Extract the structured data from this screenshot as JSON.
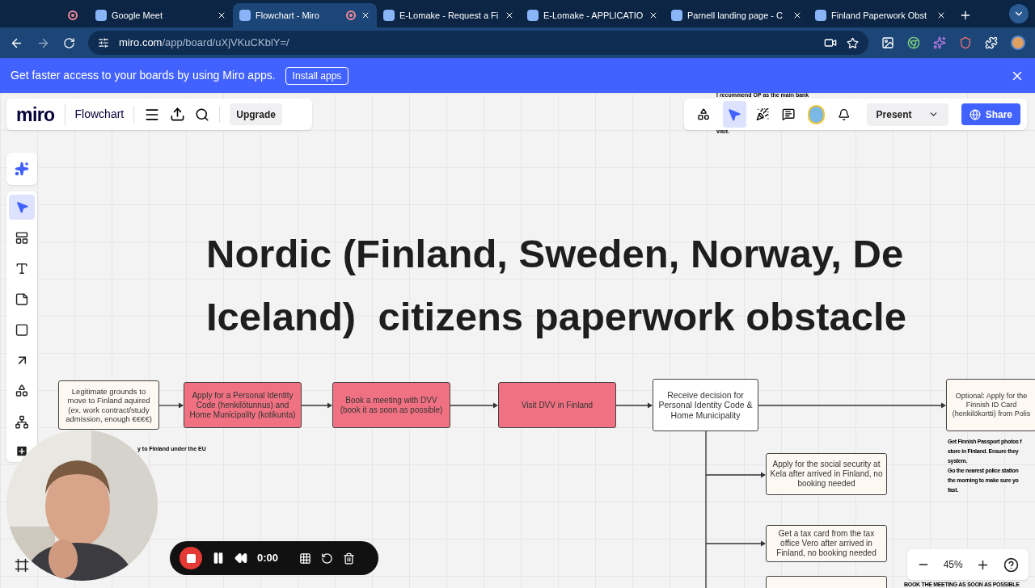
{
  "browser": {
    "tabs": [
      {
        "recording": true,
        "selected": false
      },
      {
        "title": "Google Meet",
        "recording": false,
        "selected": false
      },
      {
        "title": "Flowchart - Miro",
        "recording": true,
        "selected": true
      },
      {
        "title": "E-Lomake - Request a Fi",
        "recording": false,
        "selected": false
      },
      {
        "title": "E-Lomake - APPLICATIO",
        "recording": false,
        "selected": false
      },
      {
        "title": "Parnell landing page - C",
        "recording": false,
        "selected": false
      },
      {
        "title": "Finland Paperwork Obst",
        "recording": false,
        "selected": false
      }
    ],
    "url_host": "miro.com",
    "url_path": "/app/board/uXjVKuCKblY=/"
  },
  "banner": {
    "text": "Get faster access to your boards by using Miro apps.",
    "button": "Install apps"
  },
  "board_bar": {
    "logo": "miro",
    "board_name": "Flowchart",
    "upgrade": "Upgrade"
  },
  "top_toolbar": {
    "present": "Present",
    "share": "Share"
  },
  "canvas": {
    "title_lines": [
      "Nordic (Finland, Sweden, Norway, De",
      "Iceland)  citizens paperwork obstacle"
    ],
    "nodes": [
      {
        "text": "Legitimate grounds to move to Finland aquired (ex. work contract/study admission, enough €€€€)",
        "color": "#fdf8f1"
      },
      {
        "text": "Apply for a Personal Identity Code (henkilötunnus) and Home Municipality (kotikunta)",
        "color": "#f07282"
      },
      {
        "text": "Book a meeting with DVV (book it as soon as possible)",
        "color": "#f07282"
      },
      {
        "text": "Visit DVV in Finland",
        "color": "#f07282"
      },
      {
        "text": "Receive decision for Personal Identity Code & Home Municipality",
        "color": "#ffffff"
      },
      {
        "text": "Optional: Apply for the Finnish ID Card (henkilökortti) from Polis",
        "color": "#fdf8f1"
      },
      {
        "text": "Apply for the social security at Kela after arrived in Finland, no booking needed",
        "color": "#fdf8f1"
      },
      {
        "text": "Get a tax card from the tax office Vero after arrived in Finland, no booking needed",
        "color": "#fdf8f1"
      },
      {
        "color": "#fdf8f1"
      }
    ],
    "notes": [
      "I recommend OP as the main bank",
      "visit.",
      "y to Finland under the EU",
      "BOOK THE MEETING AS SOON AS POSSIBLE"
    ],
    "passport_note": [
      "Get Finnish Passport photos f",
      "store in Finland. Ensure they",
      "system.",
      "Go the nearest police station",
      "the morning to make sure yo",
      "fast."
    ]
  },
  "recorder": {
    "time": "0:00"
  },
  "zoom": {
    "value": "45%"
  }
}
